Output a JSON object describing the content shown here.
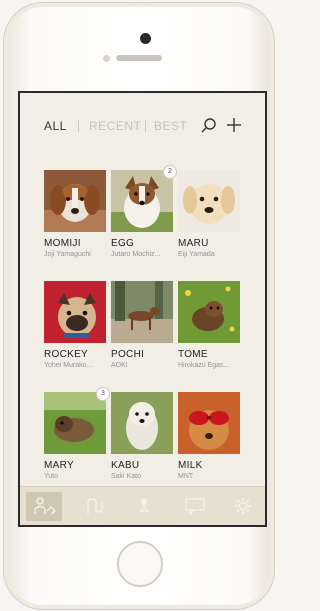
{
  "filters": {
    "all": "ALL",
    "recent": "RECENT",
    "best": "BEST"
  },
  "dogs": [
    {
      "name": "MOMIJI",
      "owner": "Joji Yamaguchi",
      "badge": ""
    },
    {
      "name": "EGG",
      "owner": "Jutaro Mochiz...",
      "badge": "2"
    },
    {
      "name": "MARU",
      "owner": "Eiji Yamada",
      "badge": ""
    },
    {
      "name": "ROCKEY",
      "owner": "Yohei Murako...",
      "badge": ""
    },
    {
      "name": "POCHI",
      "owner": "AOKI",
      "badge": ""
    },
    {
      "name": "TOME",
      "owner": "Hirokazu Egas...",
      "badge": ""
    },
    {
      "name": "MARY",
      "owner": "Yuto",
      "badge": "3"
    },
    {
      "name": "KABU",
      "owner": "Saki Kato",
      "badge": ""
    },
    {
      "name": "MILK",
      "owner": "MNT",
      "badge": ""
    }
  ],
  "tabs": [
    {
      "icon": "user-dog-icon",
      "active": true
    },
    {
      "icon": "leash-icon",
      "active": false
    },
    {
      "icon": "pawprint-icon",
      "active": false
    },
    {
      "icon": "chat-bubble-icon",
      "active": false
    },
    {
      "icon": "gear-icon",
      "active": false
    }
  ],
  "colors": {
    "screen_bg": "#f1eee6",
    "tabbar_bg": "#e6e0d1",
    "active_tab": "#cfc7b3"
  }
}
